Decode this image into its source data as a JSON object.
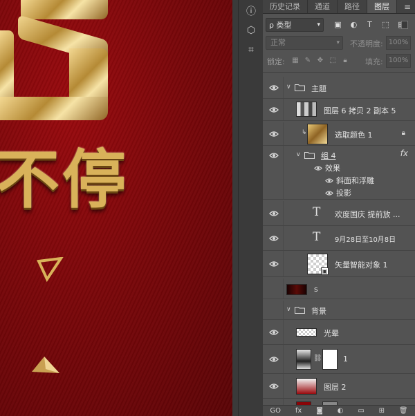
{
  "panel": {
    "tabs": [
      {
        "label": "历史记录",
        "active": false
      },
      {
        "label": "通道",
        "active": false
      },
      {
        "label": "路径",
        "active": false
      },
      {
        "label": "图层",
        "active": true
      }
    ],
    "filter_kind": "ρ 类型",
    "blend_mode": "正常",
    "opacity_label": "不透明度:",
    "opacity_value": "100%",
    "lock_label": "锁定:",
    "fill_label": "填充:",
    "fill_value": "100%"
  },
  "canvas": {
    "text": "不停",
    "background_color": "#7a070a",
    "accent_gold": "#d9b25a"
  },
  "layers": [
    {
      "name": "主题",
      "kind": "group",
      "expanded": true
    },
    {
      "name": "图层 6 拷贝 2 副本 5",
      "kind": "pixel"
    },
    {
      "name": "选取颜色 1",
      "kind": "adjustment",
      "locked": true
    },
    {
      "name": "组 4",
      "kind": "group",
      "expanded": true,
      "fx": "fx"
    },
    {
      "name": "效果",
      "kind": "effects"
    },
    {
      "name": "斜面和浮雕",
      "kind": "effect"
    },
    {
      "name": "投影",
      "kind": "effect"
    },
    {
      "name": "欢度国庆 提前放 ...",
      "kind": "text"
    },
    {
      "name": "9月28日至10月8日",
      "kind": "text"
    },
    {
      "name": "矢量智能对象 1",
      "kind": "smart"
    },
    {
      "name": "s",
      "kind": "pixel"
    },
    {
      "name": "背景",
      "kind": "group",
      "expanded": true
    },
    {
      "name": "光晕",
      "kind": "pixel"
    },
    {
      "name": "1",
      "kind": "masked"
    },
    {
      "name": "图层 2",
      "kind": "pixel"
    }
  ],
  "bottom_bar": {
    "link": "GO",
    "fx": "fx"
  }
}
